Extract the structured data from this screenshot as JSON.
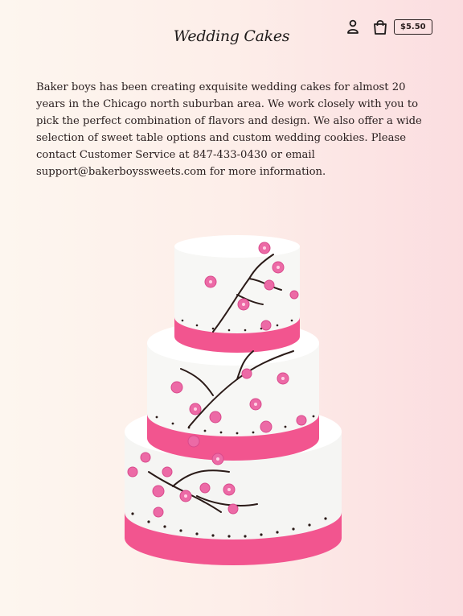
{
  "header": {
    "title": "Wedding Cakes",
    "icons": {
      "account": "account-icon",
      "cart": "cart-icon"
    },
    "cart_total": "$5.50"
  },
  "content": {
    "description": "Baker boys has been creating exquisite wedding cakes for almost 20 years in  the Chicago north suburban area. We work closely with you to pick the perfect combination of flavors and design. We also offer a wide selection of sweet table options and custom wedding cookies. Please contact Customer Service at 847-433-0430 or email support@bakerboyssweets.com for more information."
  },
  "image": {
    "subject": "three-tier white wedding cake with pink ribbons and cherry blossoms",
    "colors": {
      "fondant": "#f7f7f5",
      "ribbon": "#f2558f",
      "blossom": "#ec6aa6",
      "branch": "#2b1b18"
    }
  }
}
